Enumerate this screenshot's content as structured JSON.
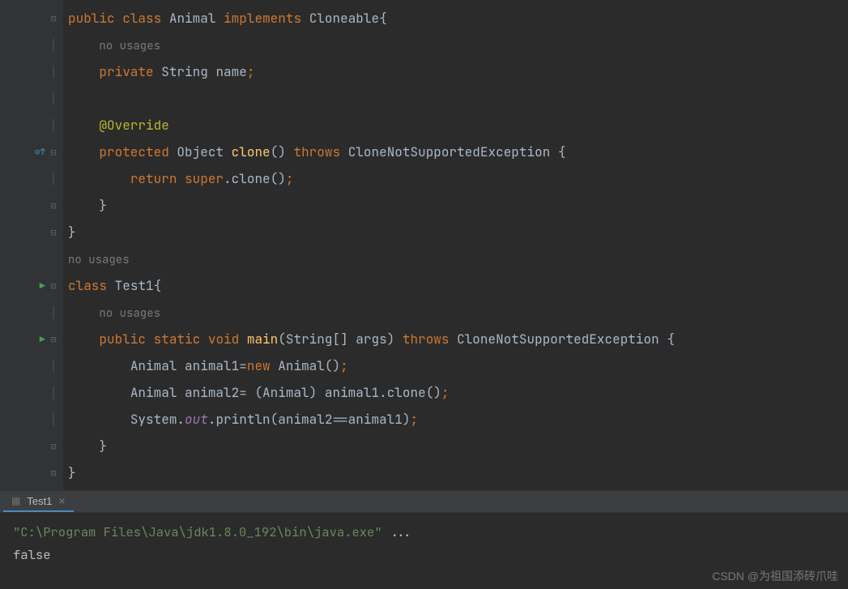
{
  "code": {
    "l1": {
      "kw1": "public",
      "kw2": "class",
      "name": "Animal",
      "kw3": "implements",
      "iface": "Cloneable",
      "brace": "{"
    },
    "l2": {
      "inlay": "no usages"
    },
    "l3": {
      "kw": "private",
      "type": "String",
      "name": "name",
      "semi": ";"
    },
    "l4": "",
    "l5": {
      "ann": "@Override"
    },
    "l6": {
      "kw1": "protected",
      "ret": "Object",
      "m": "clone",
      "paren": "()",
      "kw2": "throws",
      "ex": "CloneNotSupportedException",
      "brace": "{"
    },
    "l7": {
      "kw1": "return",
      "kw2": "super",
      "dot": ".",
      "call": "clone()",
      "semi": ";"
    },
    "l8": {
      "brace": "}"
    },
    "l9": {
      "brace": "}"
    },
    "l10": {
      "inlay": "no usages"
    },
    "l11": {
      "kw": "class",
      "name": "Test1",
      "brace": "{"
    },
    "l12": {
      "inlay": "no usages"
    },
    "l13": {
      "kw1": "public",
      "kw2": "static",
      "kw3": "void",
      "m": "main",
      "sig": "(String[] args)",
      "kw4": "throws",
      "ex": "CloneNotSupportedException",
      "brace": "{"
    },
    "l14": {
      "type": "Animal",
      "v": "animal1",
      "eq": "=",
      "kw": "new",
      "ctor": "Animal()",
      "semi": ";"
    },
    "l15": {
      "type": "Animal",
      "v": "animal2",
      "eq": "=",
      "cast": "(Animal)",
      "src": "animal1",
      "dot": ".",
      "call": "clone()",
      "semi": ";"
    },
    "l16": {
      "cls": "System",
      "dot1": ".",
      "out": "out",
      "dot2": ".",
      "m": "println",
      "arg": "(animal2==animal1)",
      "semi": ";"
    },
    "l17": {
      "brace": "}"
    },
    "l18": {
      "brace": "}"
    }
  },
  "tab": {
    "name": "Test1",
    "close": "×"
  },
  "console": {
    "l1_a": "\"C:\\Program Files\\Java\\jdk1.8.0_192\\bin\\java.exe\"",
    "l1_b": " ...",
    "l2": "false"
  },
  "watermark": "CSDN @为祖国添砖爪哇"
}
